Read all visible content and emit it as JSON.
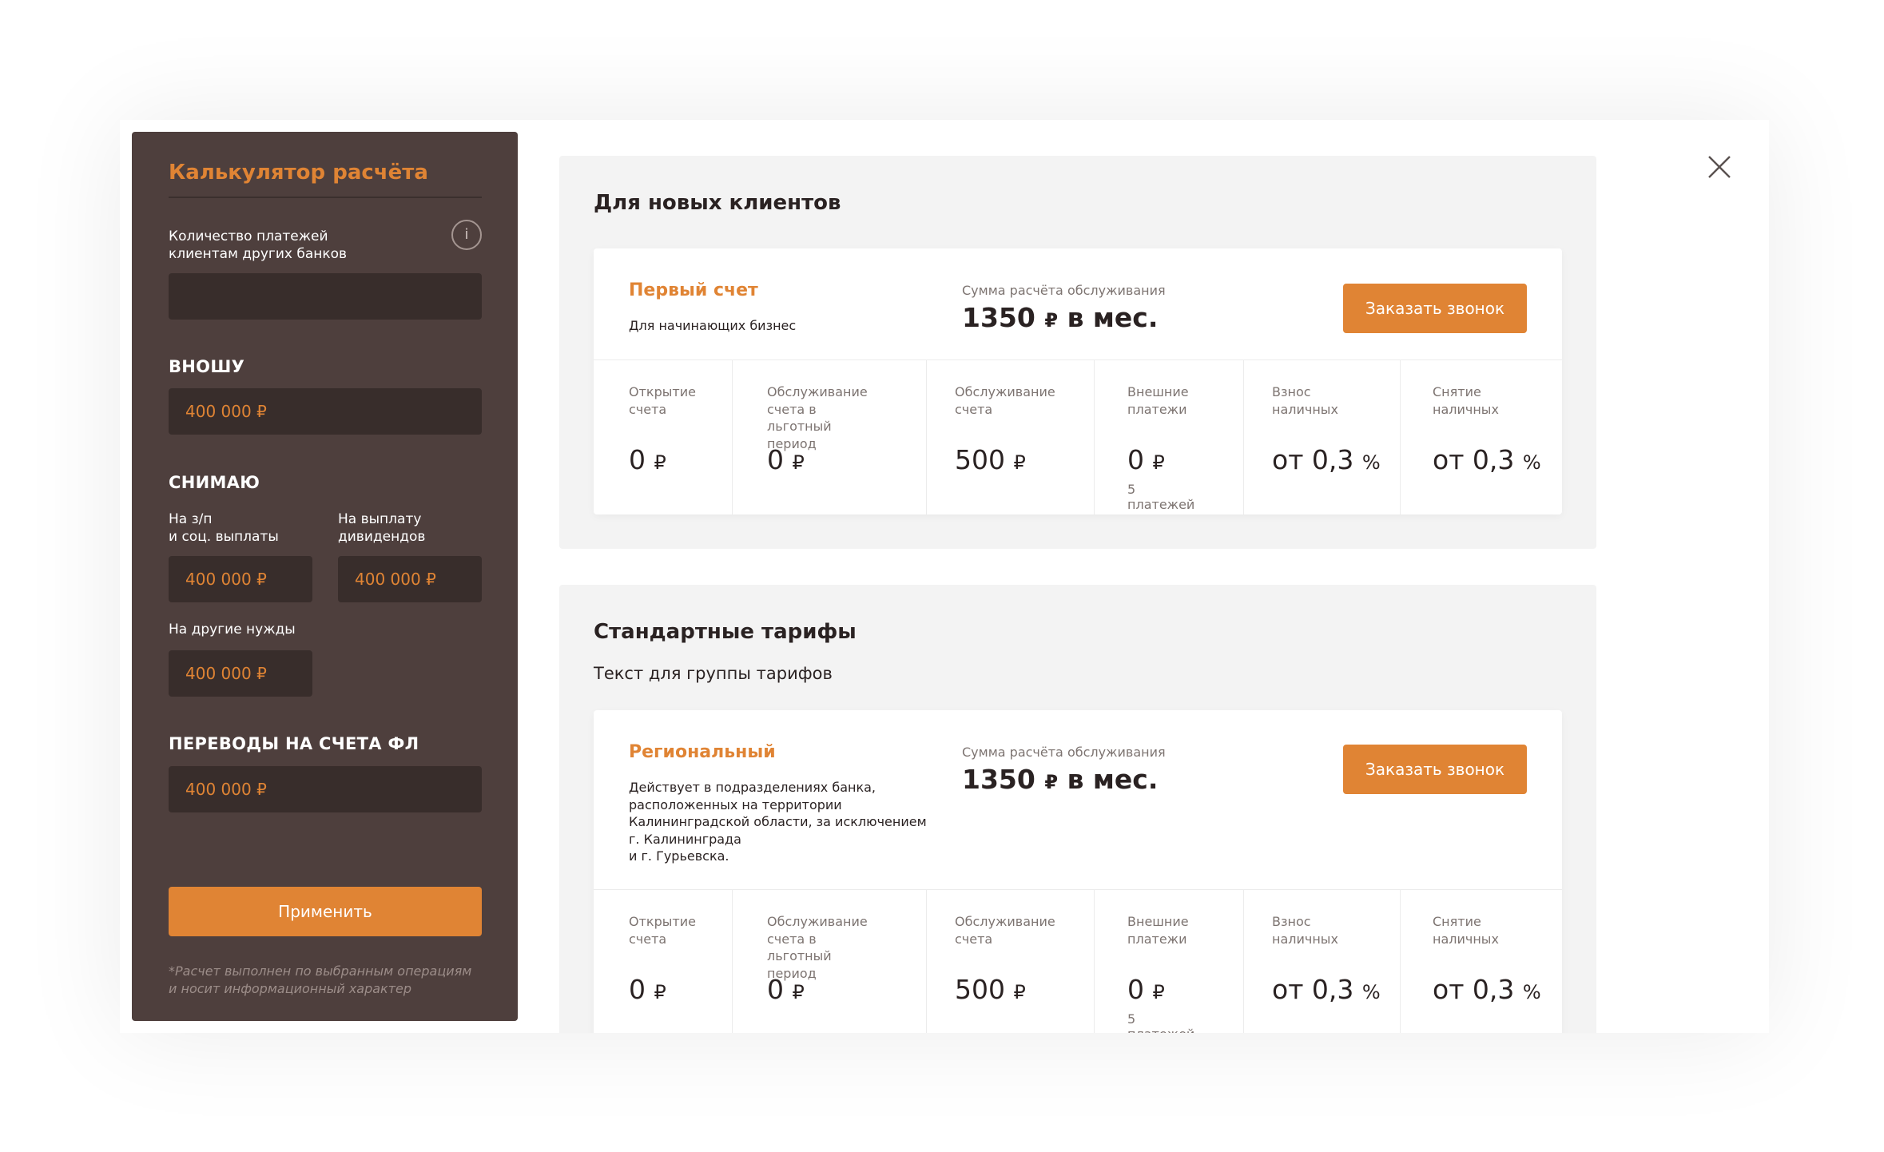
{
  "calculator": {
    "title": "Калькулятор расчёта",
    "payments_label": "Количество платежей\nклиентам других банков",
    "payments_value": "",
    "deposit_caption": "ВНОШУ",
    "deposit_value": "400 000 ₽",
    "withdraw_caption": "СНИМАЮ",
    "salary_label": "На з/п\nи соц. выплаты",
    "salary_value": "400 000 ₽",
    "dividends_label": "На выплату\nдивидендов",
    "dividends_value": "400 000 ₽",
    "other_label": "На  другие нужды",
    "other_value": "400 000 ₽",
    "transfers_caption": "ПЕРЕВОДЫ НА СЧЕТА ФЛ",
    "transfers_value": "400 000 ₽",
    "apply_label": "Применить",
    "note": "*Расчет выполнен по выбранным операциям\nи носит информационный характер"
  },
  "groups": [
    {
      "title": "Для новых клиентов",
      "text": "",
      "tariff": {
        "name": "Первый счет",
        "description": "Для начинающих бизнес",
        "sum_label": "Сумма расчёта обслуживания",
        "sum_amount": "1350",
        "sum_suffix": "в мес.",
        "call_label": "Заказать звонок"
      }
    },
    {
      "title": "Стандартные тарифы",
      "text": "Текст для группы тарифов",
      "tariff": {
        "name": "Региональный",
        "description": "Действует в подразделениях банка,\nрасположенных на территории\nКалининградской области, за исключением\nг. Калининграда\nи г. Гурьевска.",
        "sum_label": "Сумма расчёта обслуживания",
        "sum_amount": "1350",
        "sum_suffix": "в мес.",
        "call_label": "Заказать звонок"
      }
    }
  ],
  "columns": [
    {
      "label": "Открытие\nсчета",
      "value": "0",
      "unit": "₽",
      "sub": ""
    },
    {
      "label": "Обслуживание\nсчета в льготный\nпериод",
      "value": "0",
      "unit": "₽",
      "sub": ""
    },
    {
      "label": "Обслуживание\nсчета",
      "value": "500",
      "unit": "₽",
      "sub": ""
    },
    {
      "label": "Внешние\nплатежи",
      "value": "0",
      "unit": "₽",
      "sub": "5 платежей"
    },
    {
      "label": "Взнос\nналичных",
      "value": "от 0,3",
      "unit": "%",
      "sub": ""
    },
    {
      "label": "Снятие\nналичных",
      "value": "от 0,3",
      "unit": "%",
      "sub": ""
    }
  ],
  "currency_symbol": "₽",
  "colors": {
    "accent": "#e08434",
    "sidebar": "#4e3f3d",
    "field": "#382d2b",
    "group_bg": "#f3f3f3"
  },
  "icons": {
    "info": "info-icon",
    "close": "close-icon"
  }
}
